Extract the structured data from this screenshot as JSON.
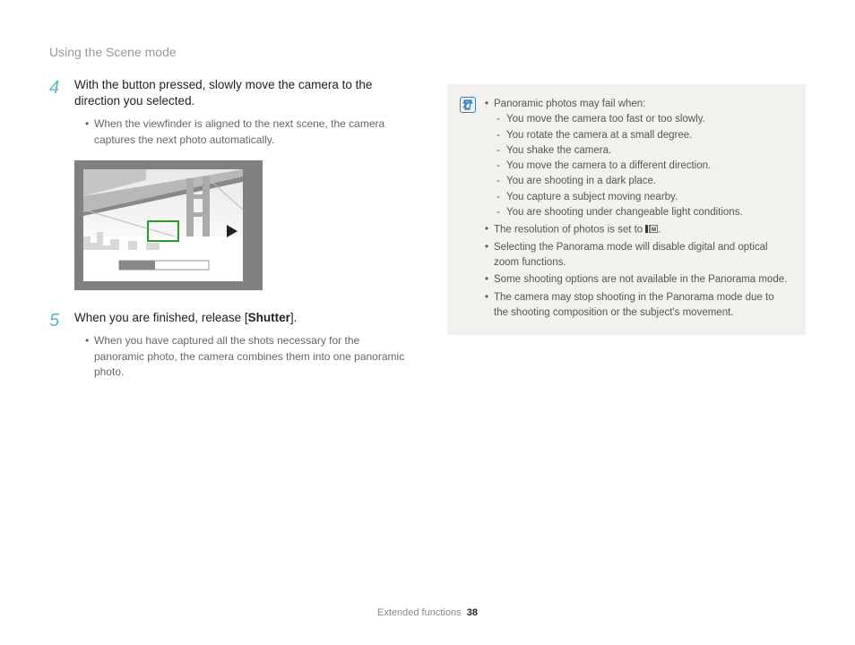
{
  "header": {
    "title": "Using the Scene mode"
  },
  "steps": {
    "s4": {
      "num": "4",
      "text": "With the button pressed, slowly move the camera to the direction you selected.",
      "sub": "When the viewfinder is aligned to the next scene, the camera captures the next photo automatically."
    },
    "s5": {
      "num": "5",
      "text_pre": "When you are finished, release [",
      "text_bold": "Shutter",
      "text_post": "].",
      "sub": "When you have captured all the shots necessary for the panoramic photo, the camera combines them into one panoramic photo."
    }
  },
  "note": {
    "b1": {
      "lead": "Panoramic photos may fail when:",
      "d1": "You move the camera too fast or too slowly.",
      "d2": "You rotate the camera at a small degree.",
      "d3": "You shake the camera.",
      "d4": "You move the camera to a different direction.",
      "d5": "You are shooting in a dark place.",
      "d6": "You capture a subject moving nearby.",
      "d7": "You are shooting under changeable light conditions."
    },
    "b2_pre": "The resolution of photos is set to ",
    "b2_post": ".",
    "b3": "Selecting the Panorama mode will disable digital and optical zoom functions.",
    "b4": "Some shooting options are not available in the Panorama mode.",
    "b5": "The camera may stop shooting in the Panorama mode due to the shooting composition or the subject's movement."
  },
  "footer": {
    "section": "Extended functions",
    "page": "38"
  }
}
